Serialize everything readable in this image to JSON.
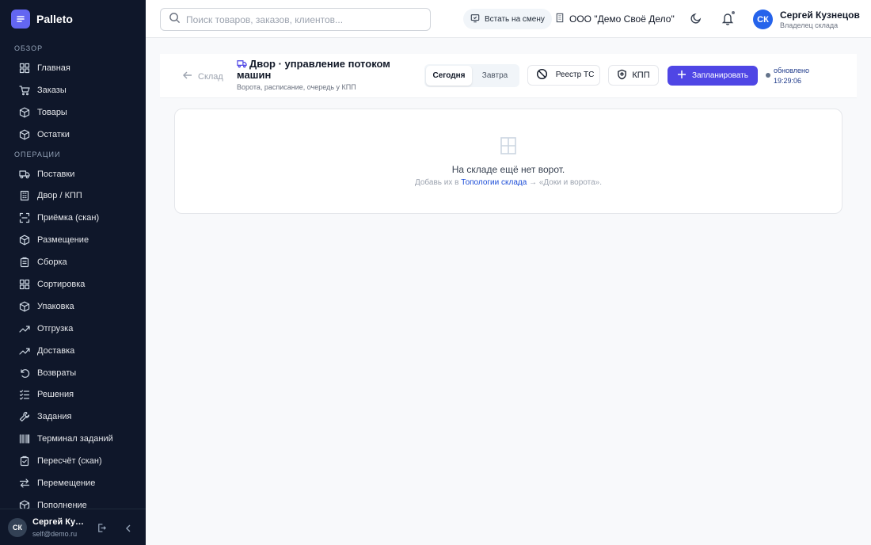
{
  "app": {
    "name": "Palleto"
  },
  "sidebar": {
    "sections": [
      {
        "title": "Обзор",
        "items": [
          {
            "label": "Главная",
            "icon": "grid-icon"
          },
          {
            "label": "Заказы",
            "icon": "cart-icon"
          },
          {
            "label": "Товары",
            "icon": "box-icon"
          },
          {
            "label": "Остатки",
            "icon": "box-icon"
          }
        ]
      },
      {
        "title": "Операции",
        "items": [
          {
            "label": "Поставки",
            "icon": "truck-icon"
          },
          {
            "label": "Двор / КПП",
            "icon": "building-icon"
          },
          {
            "label": "Приёмка (скан)",
            "icon": "scan-icon"
          },
          {
            "label": "Размещение",
            "icon": "box-icon"
          },
          {
            "label": "Сборка",
            "icon": "clipboard-icon"
          },
          {
            "label": "Сортировка",
            "icon": "grid-icon"
          },
          {
            "label": "Упаковка",
            "icon": "box-icon"
          },
          {
            "label": "Отгрузка",
            "icon": "trend-icon"
          },
          {
            "label": "Доставка",
            "icon": "trend-icon"
          },
          {
            "label": "Возвраты",
            "icon": "undo-icon"
          },
          {
            "label": "Решения",
            "icon": "checklist-icon"
          },
          {
            "label": "Задания",
            "icon": "wrench-icon"
          },
          {
            "label": "Терминал заданий",
            "icon": "barcode-icon"
          },
          {
            "label": "Пересчёт (скан)",
            "icon": "clipboard-check-icon"
          },
          {
            "label": "Перемещение",
            "icon": "swap-icon"
          },
          {
            "label": "Пополнение",
            "icon": "box-icon"
          }
        ]
      }
    ],
    "user": {
      "initials": "СК",
      "name": "Сергей Кузнецов",
      "email": "self@demo.ru"
    }
  },
  "header": {
    "search_placeholder": "Поиск товаров, заказов, клиентов...",
    "shift_label": "Встать на смену",
    "org_name": "ООО \"Демо Своё Дело\"",
    "user": {
      "initials": "СК",
      "name": "Сергей Кузнецов",
      "role": "Владелец склада"
    }
  },
  "toolbar": {
    "back_label": "Склад",
    "title": "Двор · управление потоком машин",
    "subtitle": "Ворота, расписание, очередь у КПП",
    "tabs": [
      {
        "label": "Сегодня",
        "active": true
      },
      {
        "label": "Завтра",
        "active": false
      }
    ],
    "registry_label": "Реестр ТС",
    "kpp_label": "КПП",
    "plan_label": "Запланировать",
    "updated_label": "обновлено",
    "updated_time": "19:29:06"
  },
  "empty": {
    "title": "На складе ещё нет ворот.",
    "hint_before": "Добавь их в ",
    "hint_link": "Топологии склада",
    "hint_after": " → «Доки и ворота»."
  },
  "colors": {
    "sidebar_bg": "#0f172a",
    "accent": "#4f46e5",
    "avatar": "#2563eb"
  }
}
